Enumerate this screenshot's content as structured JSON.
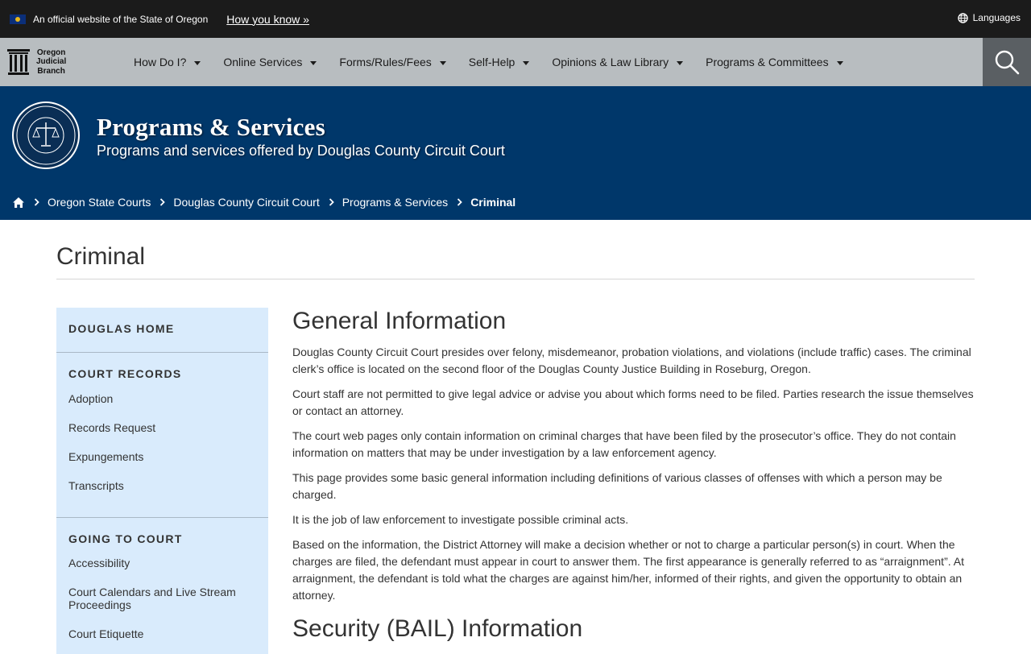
{
  "gov_banner": {
    "text": "An official website of the State of Oregon",
    "link": "How you know »",
    "languages": "Languages"
  },
  "logo": {
    "line1": "Oregon",
    "line2": "Judicial",
    "line3": "Branch"
  },
  "nav": {
    "items": [
      {
        "label": "How Do I?"
      },
      {
        "label": "Online Services"
      },
      {
        "label": "Forms/Rules/Fees"
      },
      {
        "label": "Self-Help"
      },
      {
        "label": "Opinions & Law Library"
      },
      {
        "label": "Programs & Committees"
      }
    ]
  },
  "hero": {
    "title": "Programs & Services",
    "subtitle": "Programs and services offered by Douglas County Circuit Court"
  },
  "breadcrumb": {
    "items": [
      "Oregon State Courts",
      "Douglas County Circuit Court",
      "Programs & Services"
    ],
    "current": "Criminal"
  },
  "page_title": "Criminal",
  "sidebar": {
    "home": "DOUGLAS HOME",
    "court_records": {
      "heading": "COURT RECORDS",
      "items": [
        "Adoption",
        "Records Request",
        "Expungements",
        "Transcripts"
      ]
    },
    "going_to_court": {
      "heading": "GOING TO COURT",
      "items": [
        "Accessibility",
        "Court Calendars and Live Stream Proceedings",
        "Court Etiquette"
      ]
    }
  },
  "main": {
    "heading": "General Information",
    "paragraphs": [
      "Douglas County Circuit Court presides over felony, misdemeanor, probation violations, and violations (include traffic) cases. The criminal clerk’s office is located on the second floor of the Douglas County Justice Building in Roseburg, Oregon.",
      "Court staff are not permitted to give legal advice or advise you about which forms need to be filed. Parties research the issue themselves or contact an attorney.",
      "The court web pages only contain information on criminal charges that have been filed by the prosecutor’s office. They do not contain information on matters that may be under investigation by a law enforcement agency.",
      "This page provides some basic general information including definitions of various classes of offenses with which a person may be charged.",
      "It is the job of law enforcement to investigate possible criminal acts.",
      "Based on the information, the District Attorney will make a decision whether or not to charge a particular person(s) in court. When the charges are filed, the defendant must appear in court to answer them. The first appearance is generally referred to as “arraignment”. At arraignment, the defendant is told what the charges are against him/her, informed of their rights, and given the opportunity to obtain an attorney."
    ],
    "heading2": "Security (BAIL) Information"
  },
  "colors": {
    "banner_bg": "#1b1b1b",
    "nav_bg": "#b8bdc0",
    "hero_bg": "#00376a",
    "sidebar_bg": "#d9ebfc"
  }
}
